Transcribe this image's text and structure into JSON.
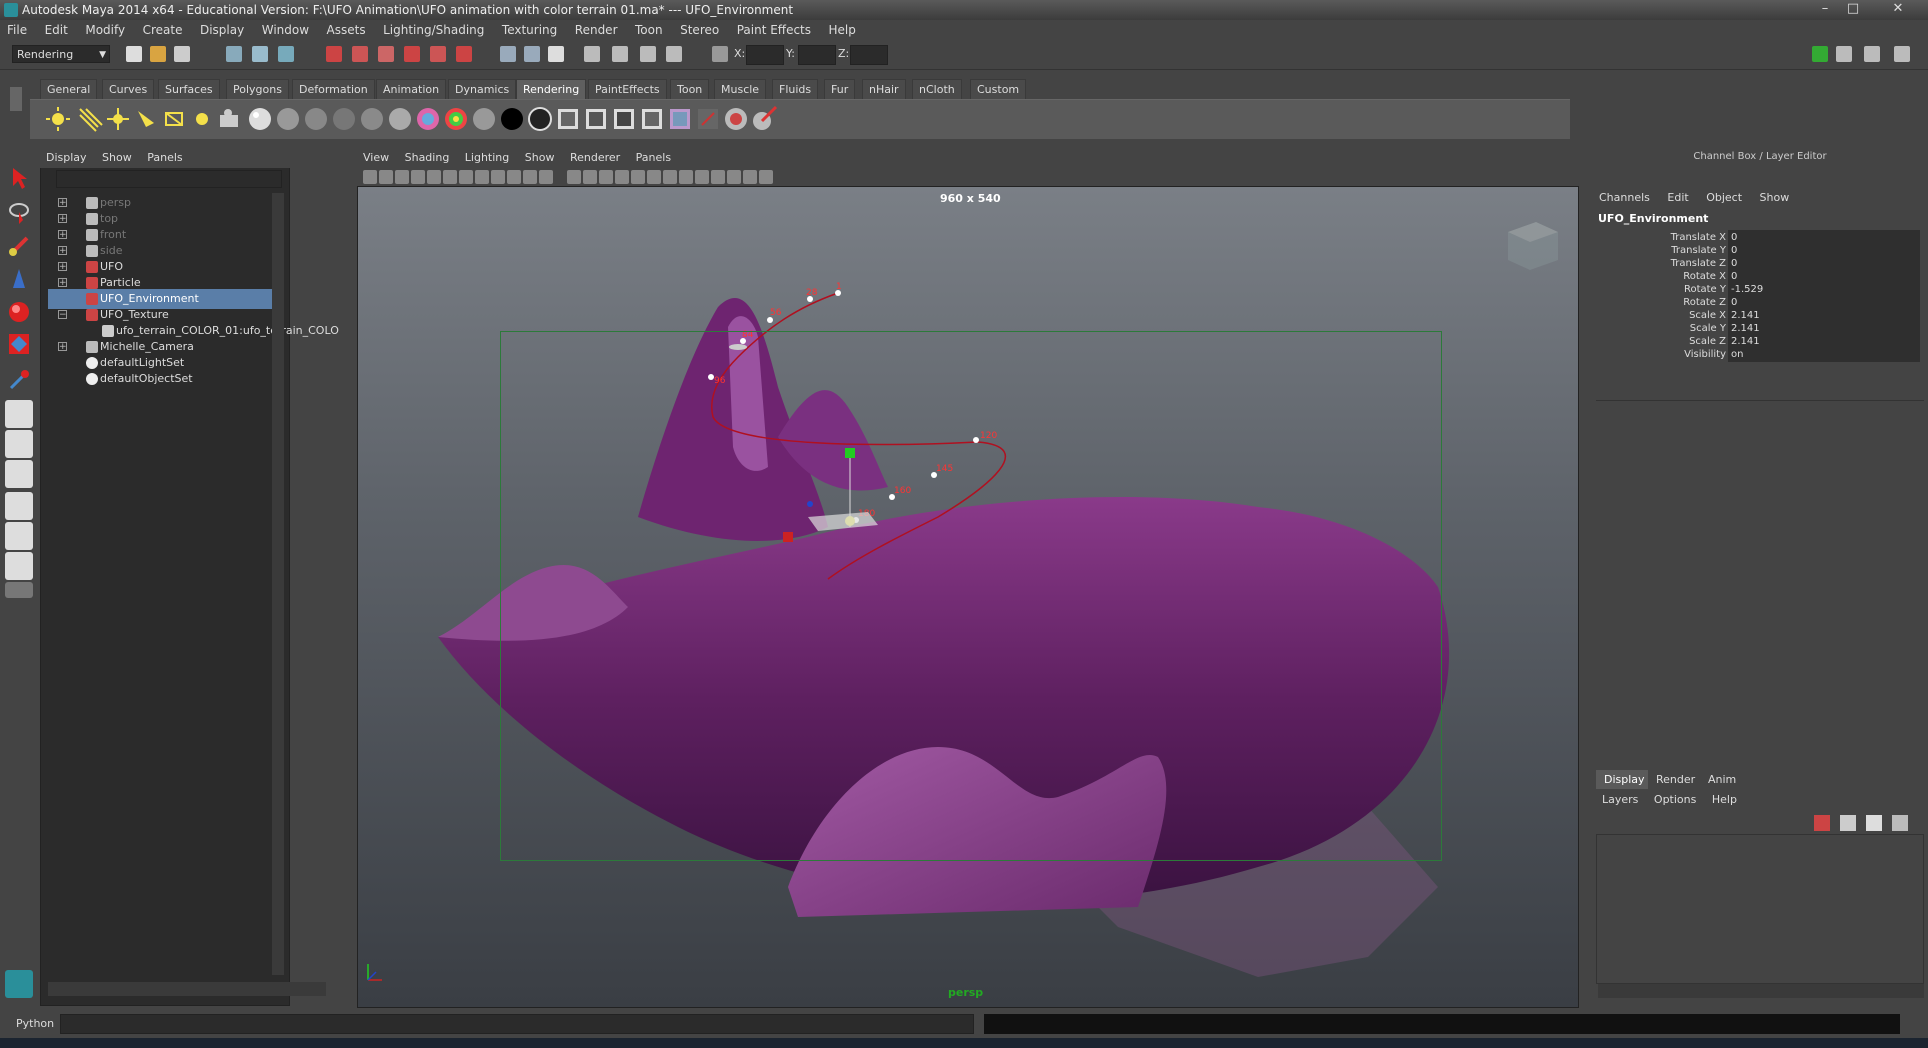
{
  "window": {
    "title": "Autodesk Maya 2014 x64 - Educational Version: F:\\UFO Animation\\UFO animation with color terrain 01.ma*  ---  UFO_Environment",
    "controls": [
      "–",
      "□",
      "✕"
    ]
  },
  "menubar": [
    "File",
    "Edit",
    "Modify",
    "Create",
    "Display",
    "Window",
    "Assets",
    "Lighting/Shading",
    "Texturing",
    "Render",
    "Toon",
    "Stereo",
    "Paint Effects",
    "Help"
  ],
  "status_line": {
    "menu_set": "Rendering",
    "x_label": "X:",
    "y_label": "Y:",
    "z_label": "Z:"
  },
  "shelf": {
    "tabs": [
      "General",
      "Curves",
      "Surfaces",
      "Polygons",
      "Deformation",
      "Animation",
      "Dynamics",
      "Rendering",
      "PaintEffects",
      "Toon",
      "Muscle",
      "Fluids",
      "Fur",
      "nHair",
      "nCloth",
      "Custom"
    ],
    "active_tab": "Rendering"
  },
  "outliner": {
    "menu": [
      "Display",
      "Show",
      "Panels"
    ],
    "items": [
      {
        "label": "persp",
        "indent": 0,
        "expander": "+",
        "dim": true,
        "icon": "camera-icon"
      },
      {
        "label": "top",
        "indent": 0,
        "expander": "+",
        "dim": true,
        "icon": "camera-icon"
      },
      {
        "label": "front",
        "indent": 0,
        "expander": "+",
        "dim": true,
        "icon": "camera-icon"
      },
      {
        "label": "side",
        "indent": 0,
        "expander": "+",
        "dim": true,
        "icon": "camera-icon"
      },
      {
        "label": "UFO",
        "indent": 0,
        "expander": "+",
        "dim": false,
        "icon": "transform-icon"
      },
      {
        "label": "Particle",
        "indent": 0,
        "expander": "+",
        "dim": false,
        "icon": "transform-icon"
      },
      {
        "label": "UFO_Environment",
        "indent": 0,
        "expander": "",
        "dim": false,
        "selected": true,
        "icon": "transform-icon"
      },
      {
        "label": "UFO_Texture",
        "indent": 0,
        "expander": "−",
        "dim": false,
        "icon": "transform-icon"
      },
      {
        "label": "ufo_terrain_COLOR_01:ufo_terrain_COLO",
        "indent": 1,
        "expander": "",
        "dim": false,
        "icon": "mesh-icon"
      },
      {
        "label": "Michelle_Camera",
        "indent": 0,
        "expander": "+",
        "dim": false,
        "icon": "camera-icon"
      },
      {
        "label": "defaultLightSet",
        "indent": 0,
        "expander": "",
        "dim": false,
        "icon": "set-icon"
      },
      {
        "label": "defaultObjectSet",
        "indent": 0,
        "expander": "",
        "dim": false,
        "icon": "set-icon"
      }
    ]
  },
  "viewport": {
    "menu": [
      "View",
      "Shading",
      "Lighting",
      "Show",
      "Renderer",
      "Panels"
    ],
    "resolution": "960 x 540",
    "camera": "persp",
    "path_labels": [
      "1",
      "28",
      "56",
      "84",
      "96",
      "120",
      "145",
      "160",
      "180"
    ]
  },
  "channel_box": {
    "header": "Channel Box / Layer Editor",
    "menu": [
      "Channels",
      "Edit",
      "Object",
      "Show"
    ],
    "object": "UFO_Environment",
    "attributes": [
      {
        "name": "Translate X",
        "value": "0"
      },
      {
        "name": "Translate Y",
        "value": "0"
      },
      {
        "name": "Translate Z",
        "value": "0"
      },
      {
        "name": "Rotate X",
        "value": "0"
      },
      {
        "name": "Rotate Y",
        "value": "-1.529"
      },
      {
        "name": "Rotate Z",
        "value": "0"
      },
      {
        "name": "Scale X",
        "value": "2.141"
      },
      {
        "name": "Scale Y",
        "value": "2.141"
      },
      {
        "name": "Scale Z",
        "value": "2.141"
      },
      {
        "name": "Visibility",
        "value": "on"
      }
    ]
  },
  "layer_editor": {
    "tabs": [
      "Display",
      "Render",
      "Anim"
    ],
    "active_tab": "Display",
    "menu": [
      "Layers",
      "Options",
      "Help"
    ]
  },
  "command_line": {
    "language": "Python"
  },
  "colors": {
    "selection": "#5a7ea8",
    "gate": "#2c7a3a",
    "path": "#b01020",
    "terrain": "#7a2a7a"
  }
}
